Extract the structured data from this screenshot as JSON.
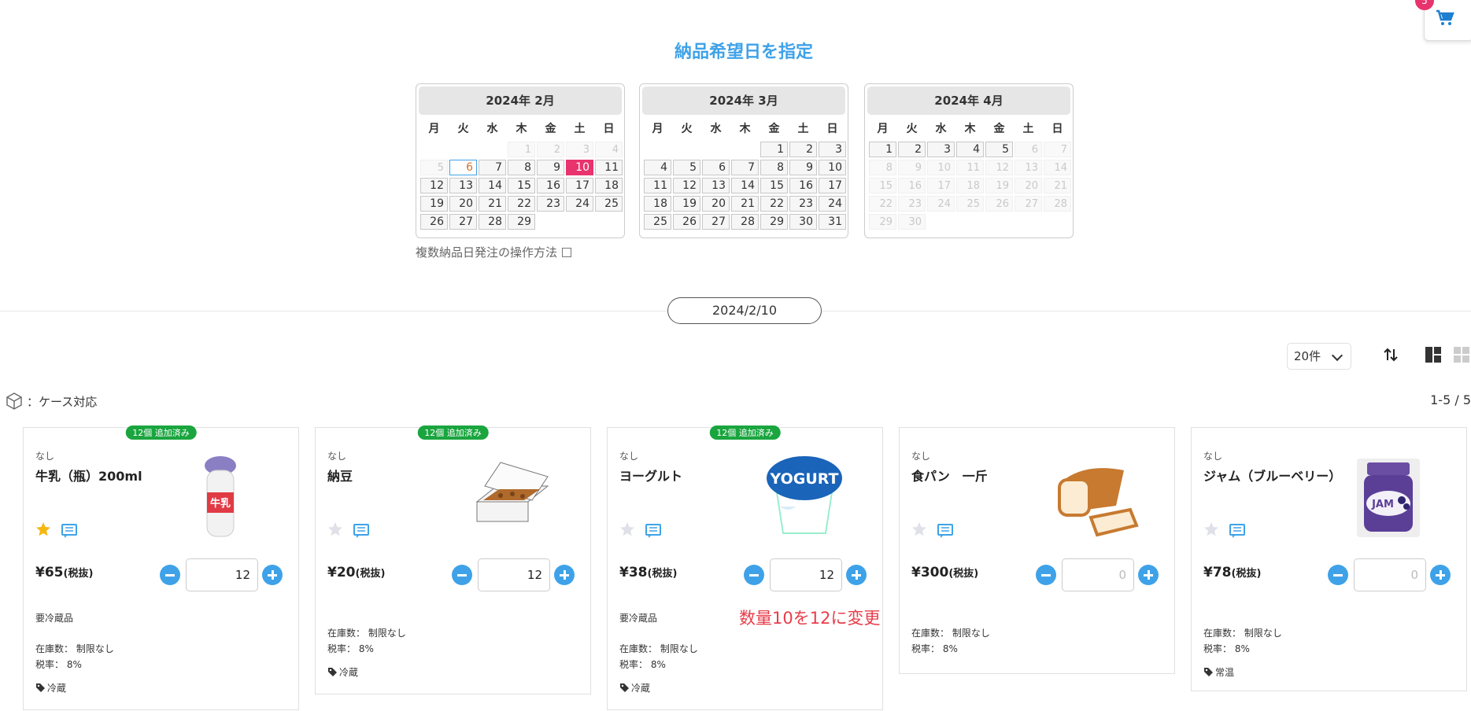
{
  "cart": {
    "badge": "5"
  },
  "title": "納品希望日を指定",
  "calendar": {
    "weekdays": [
      "月",
      "火",
      "水",
      "木",
      "金",
      "土",
      "日"
    ],
    "months": [
      {
        "label": "2024年 2月",
        "days": [
          [
            "",
            "empty"
          ],
          [
            "",
            "empty"
          ],
          [
            "",
            "empty"
          ],
          [
            "1",
            "disabled"
          ],
          [
            "2",
            "disabled"
          ],
          [
            "3",
            "disabled"
          ],
          [
            "4",
            "disabled"
          ],
          [
            "5",
            "disabled"
          ],
          [
            "6",
            "today"
          ],
          [
            "7",
            ""
          ],
          [
            "8",
            ""
          ],
          [
            "9",
            ""
          ],
          [
            "10",
            "selected"
          ],
          [
            "11",
            ""
          ],
          [
            "12",
            ""
          ],
          [
            "13",
            ""
          ],
          [
            "14",
            ""
          ],
          [
            "15",
            ""
          ],
          [
            "16",
            ""
          ],
          [
            "17",
            ""
          ],
          [
            "18",
            ""
          ],
          [
            "19",
            ""
          ],
          [
            "20",
            ""
          ],
          [
            "21",
            ""
          ],
          [
            "22",
            ""
          ],
          [
            "23",
            ""
          ],
          [
            "24",
            ""
          ],
          [
            "25",
            ""
          ],
          [
            "26",
            ""
          ],
          [
            "27",
            ""
          ],
          [
            "28",
            ""
          ],
          [
            "29",
            ""
          ]
        ]
      },
      {
        "label": "2024年 3月",
        "days": [
          [
            "",
            "empty"
          ],
          [
            "",
            "empty"
          ],
          [
            "",
            "empty"
          ],
          [
            "",
            "empty"
          ],
          [
            "1",
            ""
          ],
          [
            "2",
            ""
          ],
          [
            "3",
            ""
          ],
          [
            "4",
            ""
          ],
          [
            "5",
            ""
          ],
          [
            "6",
            ""
          ],
          [
            "7",
            ""
          ],
          [
            "8",
            ""
          ],
          [
            "9",
            ""
          ],
          [
            "10",
            ""
          ],
          [
            "11",
            ""
          ],
          [
            "12",
            ""
          ],
          [
            "13",
            ""
          ],
          [
            "14",
            ""
          ],
          [
            "15",
            ""
          ],
          [
            "16",
            ""
          ],
          [
            "17",
            ""
          ],
          [
            "18",
            ""
          ],
          [
            "19",
            ""
          ],
          [
            "20",
            ""
          ],
          [
            "21",
            ""
          ],
          [
            "22",
            ""
          ],
          [
            "23",
            ""
          ],
          [
            "24",
            ""
          ],
          [
            "25",
            ""
          ],
          [
            "26",
            ""
          ],
          [
            "27",
            ""
          ],
          [
            "28",
            ""
          ],
          [
            "29",
            ""
          ],
          [
            "30",
            ""
          ],
          [
            "31",
            ""
          ]
        ]
      },
      {
        "label": "2024年 4月",
        "days": [
          [
            "1",
            ""
          ],
          [
            "2",
            ""
          ],
          [
            "3",
            ""
          ],
          [
            "4",
            ""
          ],
          [
            "5",
            ""
          ],
          [
            "6",
            "disabled"
          ],
          [
            "7",
            "disabled"
          ],
          [
            "8",
            "disabled"
          ],
          [
            "9",
            "disabled"
          ],
          [
            "10",
            "disabled"
          ],
          [
            "11",
            "disabled"
          ],
          [
            "12",
            "disabled"
          ],
          [
            "13",
            "disabled"
          ],
          [
            "14",
            "disabled"
          ],
          [
            "15",
            "disabled"
          ],
          [
            "16",
            "disabled"
          ],
          [
            "17",
            "disabled"
          ],
          [
            "18",
            "disabled"
          ],
          [
            "19",
            "disabled"
          ],
          [
            "20",
            "disabled"
          ],
          [
            "21",
            "disabled"
          ],
          [
            "22",
            "disabled"
          ],
          [
            "23",
            "disabled"
          ],
          [
            "24",
            "disabled"
          ],
          [
            "25",
            "disabled"
          ],
          [
            "26",
            "disabled"
          ],
          [
            "27",
            "disabled"
          ],
          [
            "28",
            "disabled"
          ],
          [
            "29",
            "disabled"
          ],
          [
            "30",
            "disabled"
          ]
        ]
      }
    ]
  },
  "multi_link": "複数納品日発注の操作方法",
  "selected_date": "2024/2/10",
  "per_page": "20件",
  "case_legend": "：ケース対応",
  "result_count": "1-5 / 5",
  "colors": {
    "accent": "#3fa2e8",
    "selected": "#e8336e",
    "added": "#1aa53f",
    "annotation": "#e83d4a"
  },
  "products": [
    {
      "badge": "12個 追加済み",
      "category": "なし",
      "name": "牛乳（瓶）200ml",
      "image": "milk-bottle",
      "favorite": true,
      "price": "¥65",
      "price_note": "(税抜)",
      "qty": "12",
      "note": "要冷蔵品",
      "stock": "在庫数： 制限なし",
      "tax": "税率： 8%",
      "tag": "冷蔵"
    },
    {
      "badge": "12個 追加済み",
      "category": "なし",
      "name": "納豆",
      "image": "natto-pack",
      "favorite": false,
      "price": "¥20",
      "price_note": "(税抜)",
      "qty": "12",
      "note": "",
      "stock": "在庫数： 制限なし",
      "tax": "税率： 8%",
      "tag": "冷蔵"
    },
    {
      "badge": "12個 追加済み",
      "category": "なし",
      "name": "ヨーグルト",
      "image": "yogurt-cup",
      "favorite": false,
      "price": "¥38",
      "price_note": "(税抜)",
      "qty": "12",
      "note": "要冷蔵品",
      "stock": "在庫数： 制限なし",
      "tax": "税率： 8%",
      "tag": "冷蔵",
      "annotation": "数量10を12に変更"
    },
    {
      "badge": "",
      "category": "なし",
      "name": "食パン　一斤",
      "image": "bread-loaf",
      "favorite": false,
      "price": "¥300",
      "price_note": "(税抜)",
      "qty": "0",
      "note": "",
      "stock": "在庫数： 制限なし",
      "tax": "税率： 8%",
      "tag": ""
    },
    {
      "badge": "",
      "category": "なし",
      "name": "ジャム（ブルーベリー）",
      "image": "jam-jar",
      "favorite": false,
      "price": "¥78",
      "price_note": "(税抜)",
      "qty": "0",
      "note": "",
      "stock": "在庫数： 制限なし",
      "tax": "税率： 8%",
      "tag": "常温"
    }
  ]
}
